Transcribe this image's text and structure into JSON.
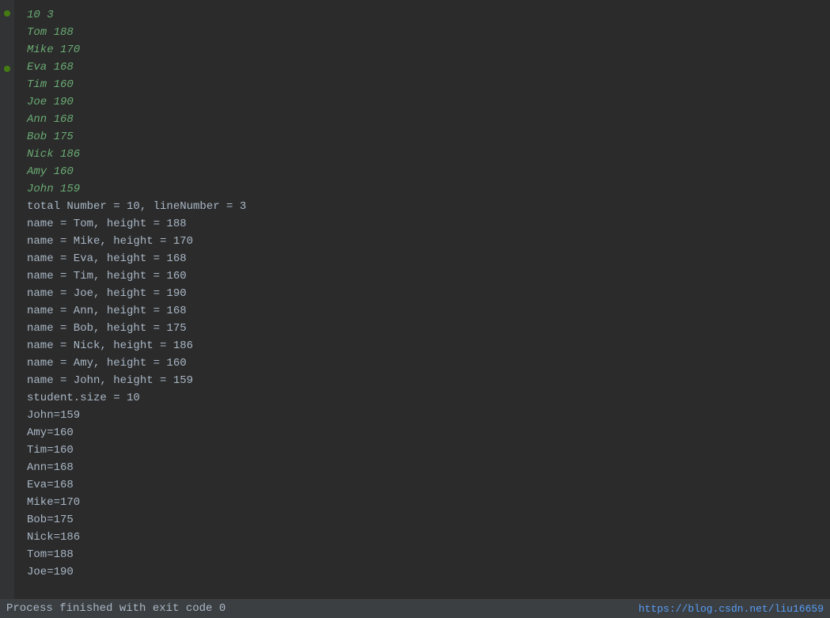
{
  "terminal": {
    "background": "#2b2b2b",
    "gutter_background": "#313335",
    "green_lines": [
      "10 3",
      "Tom 188",
      "Mike 170",
      "Eva 168",
      "Tim 160",
      "Joe 190",
      "Ann 168",
      "Bob 175",
      "Nick 186",
      "Amy 160",
      "John 159"
    ],
    "white_lines": [
      "total Number = 10, lineNumber = 3",
      "name = Tom, height = 188",
      "name = Mike, height = 170",
      "name = Eva, height = 168",
      "name = Tim, height = 160",
      "name = Joe, height = 190",
      "name = Ann, height = 168",
      "name = Bob, height = 175",
      "name = Nick, height = 186",
      "name = Amy, height = 160",
      "name = John, height = 159",
      "student.size = 10",
      "John=159",
      "Amy=160",
      "Tim=160",
      "Ann=168",
      "Eva=168",
      "Mike=170",
      "Bob=175",
      "Nick=186",
      "Tom=188",
      "Joe=190"
    ],
    "process_line": "Process finished with exit code 0",
    "url": "https://blog.csdn.net/liu16659"
  }
}
